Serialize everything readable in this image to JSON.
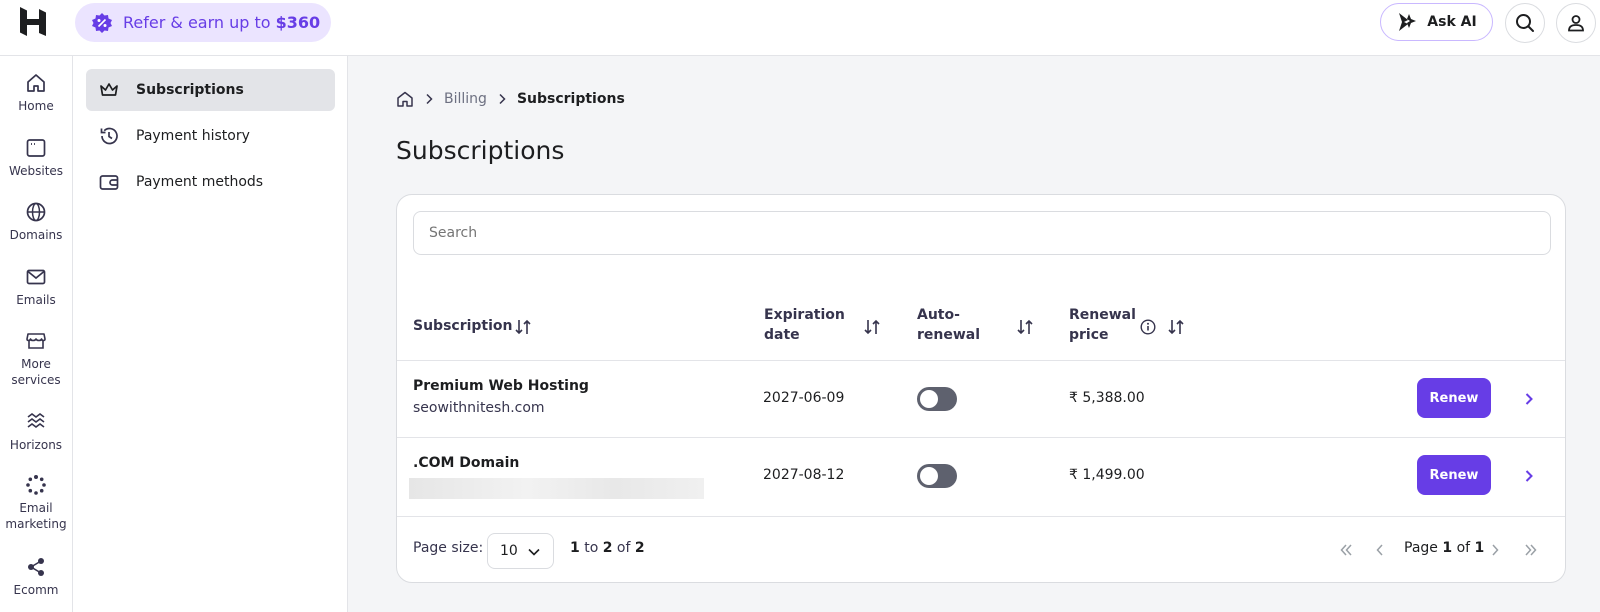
{
  "topbar": {
    "refer_text": "Refer & earn up to",
    "refer_amount": "$360",
    "ask_ai": "Ask AI"
  },
  "rail": [
    {
      "label": "Home"
    },
    {
      "label": "Websites"
    },
    {
      "label": "Domains"
    },
    {
      "label": "Emails"
    },
    {
      "label": "More services"
    },
    {
      "label": "Horizons"
    },
    {
      "label": "Email marketing"
    },
    {
      "label": "Ecomm"
    }
  ],
  "subnav": {
    "items": [
      {
        "label": "Subscriptions"
      },
      {
        "label": "Payment history"
      },
      {
        "label": "Payment methods"
      }
    ]
  },
  "breadcrumb": {
    "billing": "Billing",
    "current": "Subscriptions"
  },
  "page_title": "Subscriptions",
  "search": {
    "placeholder": "Search"
  },
  "table": {
    "headers": {
      "subscription": "Subscription",
      "expiration_1": "Expiration",
      "expiration_2": "date",
      "auto_1": "Auto-",
      "auto_2": "renewal",
      "price_1": "Renewal",
      "price_2": "price"
    },
    "rows": [
      {
        "name": "Premium Web Hosting",
        "sub": "seowithnitesh.com",
        "expiration": "2027-06-09",
        "auto_renewal": false,
        "price": "₹ 5,388.00",
        "action": "Renew"
      },
      {
        "name": ".COM Domain",
        "sub": "",
        "expiration": "2027-08-12",
        "auto_renewal": false,
        "price": "₹ 1,499.00",
        "action": "Renew"
      }
    ]
  },
  "footer": {
    "page_size_label": "Page size:",
    "page_size": "10",
    "range_from": "1",
    "range_to_word": "to",
    "range_to": "2",
    "range_of_word": "of",
    "range_total": "2",
    "page_word": "Page",
    "page_current": "1",
    "page_of_word": "of",
    "page_total": "1"
  },
  "colors": {
    "accent": "#673de6",
    "refer_bg": "#ebe4ff"
  }
}
